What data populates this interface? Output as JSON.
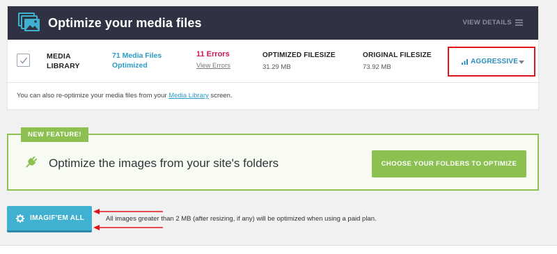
{
  "header": {
    "title": "Optimize your media files",
    "view_details": "VIEW DETAILS",
    "icon": "media-stack-icon"
  },
  "stats": {
    "library_line1": "MEDIA",
    "library_line2": "LIBRARY",
    "files_line1": "71 Media Files",
    "files_line2": "Optimized",
    "errors_count": "11 Errors",
    "errors_link": "View Errors",
    "optimized_label": "OPTIMIZED FILESIZE",
    "optimized_value": "31.29 MB",
    "original_label": "ORIGINAL FILESIZE",
    "original_value": "73.92 MB",
    "level": "AGGRESSIVE"
  },
  "reoptimize": {
    "before": "You can also re-optimize your media files from your ",
    "link": "Media Library",
    "after": " screen."
  },
  "feature": {
    "tag": "NEW FEATURE!",
    "title": "Optimize the images from your site's folders",
    "button": "CHOOSE YOUR FOLDERS TO OPTIMIZE",
    "icon": "plug-icon"
  },
  "bulk": {
    "button": "IMAGIF'EM ALL",
    "note": "All images greater than 2 MB (after resizing, if any) will be optimized when using a paid plan.",
    "icon": "gear-icon"
  },
  "colors": {
    "header_bg": "#2e3243",
    "accent_blue": "#2b9bc6",
    "error_red": "#d0164e",
    "feature_green": "#8cc152",
    "bulk_button": "#40b1d0",
    "annotation_red": "#e0151b"
  }
}
